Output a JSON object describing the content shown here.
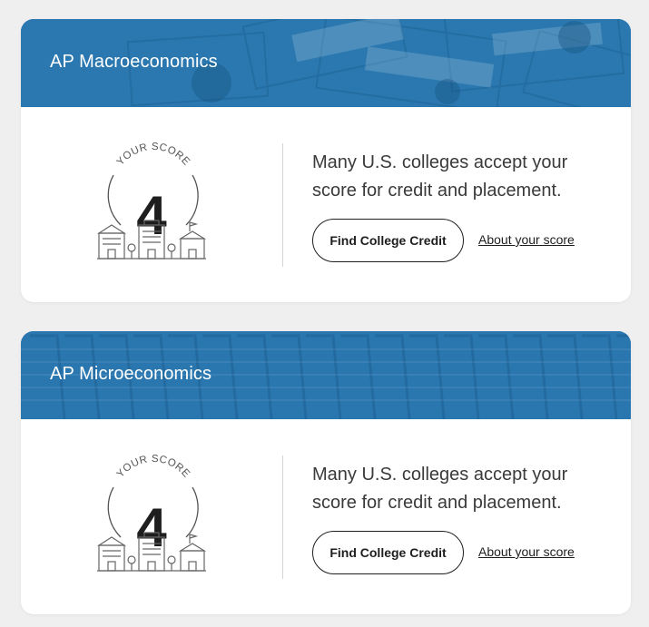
{
  "cards": [
    {
      "title": "AP Macroeconomics",
      "banner_image": "money-banknotes-background",
      "score_label": "YOUR SCORE",
      "score": "4",
      "message": "Many U.S. colleges accept your score for credit and placement.",
      "button_label": "Find College Credit",
      "link_label": "About your score"
    },
    {
      "title": "AP Microeconomics",
      "banner_image": "shopping-carts-background",
      "score_label": "YOUR SCORE",
      "score": "4",
      "message": "Many U.S. colleges accept your score for credit and placement.",
      "button_label": "Find College Credit",
      "link_label": "About your score"
    }
  ],
  "colors": {
    "banner_blue": "#2a78b0",
    "page_background": "#efefef",
    "text_dark": "#1e1e1e"
  }
}
